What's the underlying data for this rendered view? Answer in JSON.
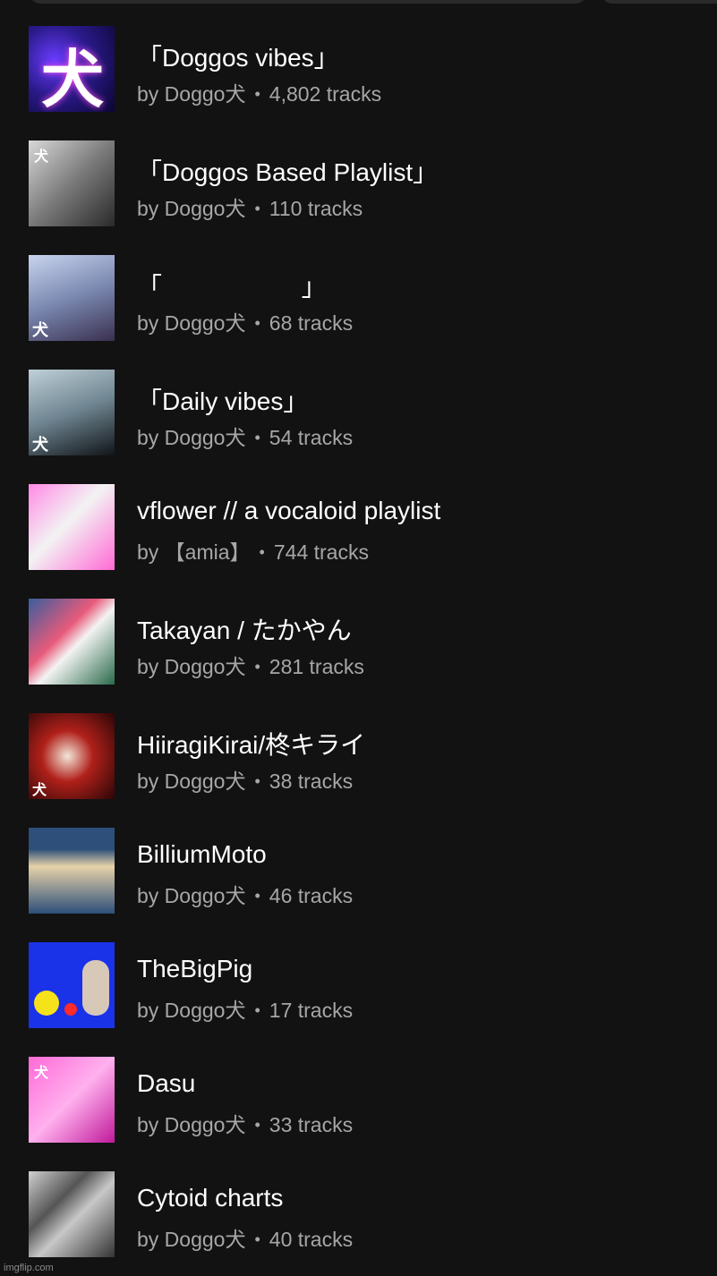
{
  "playlists": [
    {
      "title": "「Doggos vibes」",
      "owner": "by Doggo犬",
      "tracks": "4,802 tracks",
      "accent": "#5b2cff"
    },
    {
      "title": "「Doggos Based Playlist」",
      "owner": "by Doggo犬",
      "tracks": "110 tracks",
      "accent": "#7a7a7a"
    },
    {
      "title": "「                    」",
      "owner": "by Doggo犬",
      "tracks": "68 tracks",
      "accent": "#8890b8"
    },
    {
      "title": "「Daily vibes」",
      "owner": "by Doggo犬",
      "tracks": "54 tracks",
      "accent": "#8fa3ad"
    },
    {
      "title": "vflower // a vocaloid playlist",
      "owner": "by 【amia】",
      "tracks": "744 tracks",
      "accent": "#ff7ae0"
    },
    {
      "title": "Takayan / たかやん",
      "owner": "by Doggo犬",
      "tracks": "281 tracks",
      "accent": "#3a5e9e"
    },
    {
      "title": "HiiragiKirai/柊キライ",
      "owner": "by Doggo犬",
      "tracks": "38 tracks",
      "accent": "#b0201a"
    },
    {
      "title": "BilliumMoto",
      "owner": "by Doggo犬",
      "tracks": "46 tracks",
      "accent": "#2d4f7a"
    },
    {
      "title": "TheBigPig",
      "owner": "by Doggo犬",
      "tracks": "17 tracks",
      "accent": "#1a32e8"
    },
    {
      "title": "Dasu",
      "owner": "by Doggo犬",
      "tracks": "33 tracks",
      "accent": "#ff6ad8"
    },
    {
      "title": "Cytoid charts",
      "owner": "by Doggo犬",
      "tracks": "40 tracks",
      "accent": "#8a8a8a"
    }
  ],
  "cover_glyph": "犬",
  "watermark": "imgflip.com"
}
